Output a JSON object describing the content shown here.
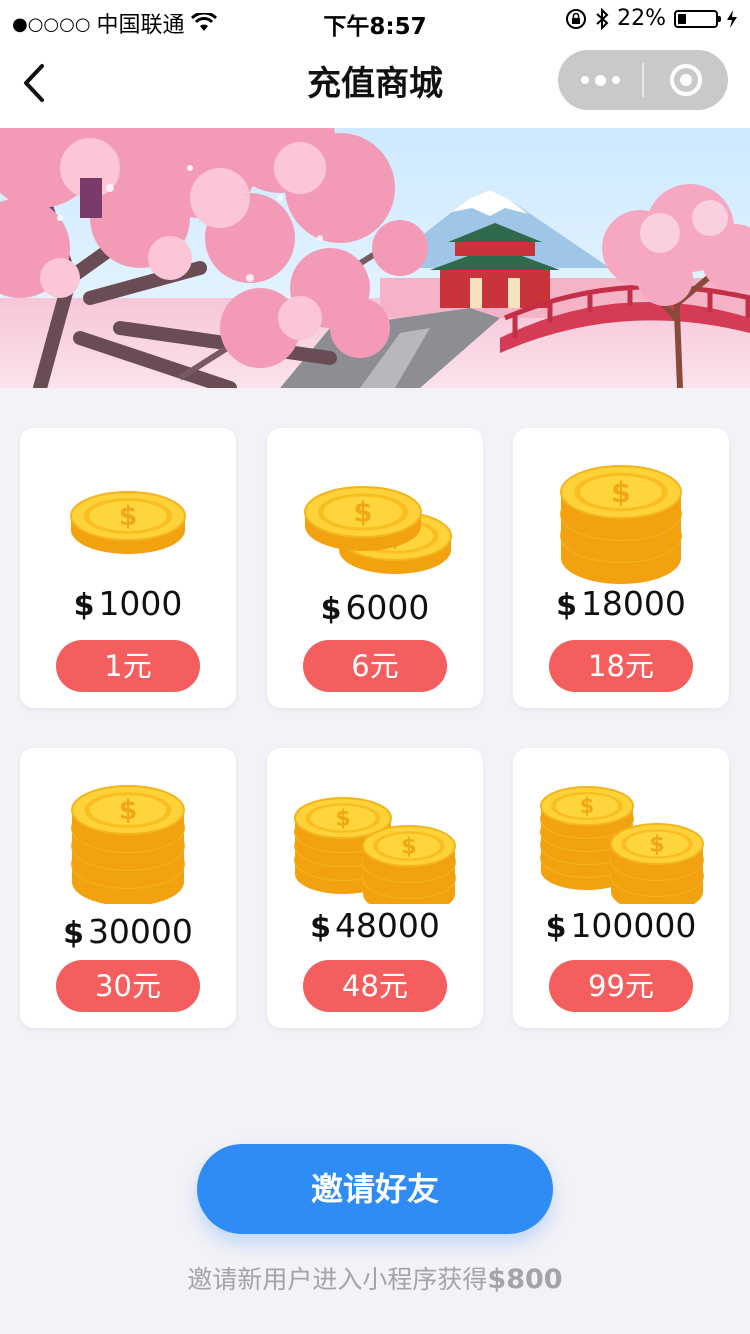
{
  "status_bar": {
    "signal_dots": "●○○○○",
    "carrier": "中国联通",
    "time": "下午8:57",
    "battery_percent": "22%",
    "battery_level": 0.22,
    "icons": [
      "wifi-icon",
      "rotation-lock-icon",
      "bluetooth-icon",
      "charging-icon"
    ]
  },
  "navbar": {
    "title": "充值商城",
    "back_icon": "chevron-left-icon",
    "capsule_icons": [
      "more-dots-icon",
      "close-circle-icon"
    ]
  },
  "banner": {
    "theme": "cherry blossom japanese temple illustration"
  },
  "products": [
    {
      "currency": "$",
      "amount": "1000",
      "price": "1元",
      "coin_style": "single"
    },
    {
      "currency": "$",
      "amount": "6000",
      "price": "6元",
      "coin_style": "two"
    },
    {
      "currency": "$",
      "amount": "18000",
      "price": "18元",
      "coin_style": "stack3"
    },
    {
      "currency": "$",
      "amount": "30000",
      "price": "30元",
      "coin_style": "stack4"
    },
    {
      "currency": "$",
      "amount": "48000",
      "price": "48元",
      "coin_style": "two-stacks"
    },
    {
      "currency": "$",
      "amount": "100000",
      "price": "99元",
      "coin_style": "two-tall-stacks"
    }
  ],
  "invite": {
    "button_label": "邀请好友",
    "hint_prefix": "邀请新用户进入小程序获得",
    "hint_money": "$800"
  },
  "colors": {
    "price_badge": "#f45e5e",
    "invite_button": "#2f8cf5",
    "coin_gold": "#f7c325",
    "page_bg": "#f3f2f7"
  }
}
